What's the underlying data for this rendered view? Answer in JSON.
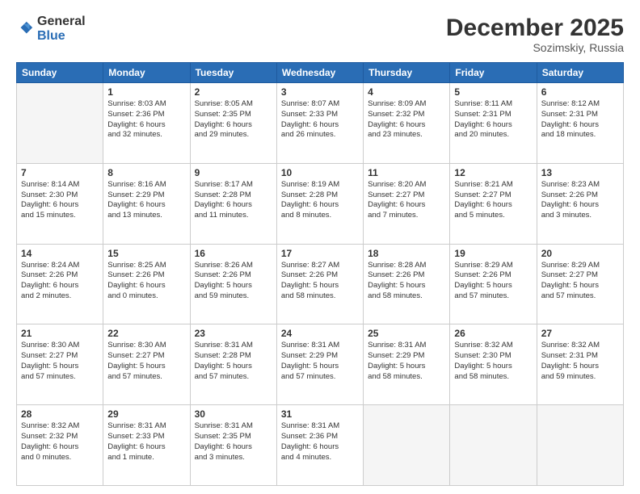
{
  "logo": {
    "general": "General",
    "blue": "Blue"
  },
  "title": "December 2025",
  "location": "Sozimskiy, Russia",
  "days_of_week": [
    "Sunday",
    "Monday",
    "Tuesday",
    "Wednesday",
    "Thursday",
    "Friday",
    "Saturday"
  ],
  "weeks": [
    [
      {
        "day": "",
        "info": "",
        "empty": true
      },
      {
        "day": "1",
        "info": "Sunrise: 8:03 AM\nSunset: 2:36 PM\nDaylight: 6 hours\nand 32 minutes."
      },
      {
        "day": "2",
        "info": "Sunrise: 8:05 AM\nSunset: 2:35 PM\nDaylight: 6 hours\nand 29 minutes."
      },
      {
        "day": "3",
        "info": "Sunrise: 8:07 AM\nSunset: 2:33 PM\nDaylight: 6 hours\nand 26 minutes."
      },
      {
        "day": "4",
        "info": "Sunrise: 8:09 AM\nSunset: 2:32 PM\nDaylight: 6 hours\nand 23 minutes."
      },
      {
        "day": "5",
        "info": "Sunrise: 8:11 AM\nSunset: 2:31 PM\nDaylight: 6 hours\nand 20 minutes."
      },
      {
        "day": "6",
        "info": "Sunrise: 8:12 AM\nSunset: 2:31 PM\nDaylight: 6 hours\nand 18 minutes."
      }
    ],
    [
      {
        "day": "7",
        "info": "Sunrise: 8:14 AM\nSunset: 2:30 PM\nDaylight: 6 hours\nand 15 minutes."
      },
      {
        "day": "8",
        "info": "Sunrise: 8:16 AM\nSunset: 2:29 PM\nDaylight: 6 hours\nand 13 minutes."
      },
      {
        "day": "9",
        "info": "Sunrise: 8:17 AM\nSunset: 2:28 PM\nDaylight: 6 hours\nand 11 minutes."
      },
      {
        "day": "10",
        "info": "Sunrise: 8:19 AM\nSunset: 2:28 PM\nDaylight: 6 hours\nand 8 minutes."
      },
      {
        "day": "11",
        "info": "Sunrise: 8:20 AM\nSunset: 2:27 PM\nDaylight: 6 hours\nand 7 minutes."
      },
      {
        "day": "12",
        "info": "Sunrise: 8:21 AM\nSunset: 2:27 PM\nDaylight: 6 hours\nand 5 minutes."
      },
      {
        "day": "13",
        "info": "Sunrise: 8:23 AM\nSunset: 2:26 PM\nDaylight: 6 hours\nand 3 minutes."
      }
    ],
    [
      {
        "day": "14",
        "info": "Sunrise: 8:24 AM\nSunset: 2:26 PM\nDaylight: 6 hours\nand 2 minutes."
      },
      {
        "day": "15",
        "info": "Sunrise: 8:25 AM\nSunset: 2:26 PM\nDaylight: 6 hours\nand 0 minutes."
      },
      {
        "day": "16",
        "info": "Sunrise: 8:26 AM\nSunset: 2:26 PM\nDaylight: 5 hours\nand 59 minutes."
      },
      {
        "day": "17",
        "info": "Sunrise: 8:27 AM\nSunset: 2:26 PM\nDaylight: 5 hours\nand 58 minutes."
      },
      {
        "day": "18",
        "info": "Sunrise: 8:28 AM\nSunset: 2:26 PM\nDaylight: 5 hours\nand 58 minutes."
      },
      {
        "day": "19",
        "info": "Sunrise: 8:29 AM\nSunset: 2:26 PM\nDaylight: 5 hours\nand 57 minutes."
      },
      {
        "day": "20",
        "info": "Sunrise: 8:29 AM\nSunset: 2:27 PM\nDaylight: 5 hours\nand 57 minutes."
      }
    ],
    [
      {
        "day": "21",
        "info": "Sunrise: 8:30 AM\nSunset: 2:27 PM\nDaylight: 5 hours\nand 57 minutes."
      },
      {
        "day": "22",
        "info": "Sunrise: 8:30 AM\nSunset: 2:27 PM\nDaylight: 5 hours\nand 57 minutes."
      },
      {
        "day": "23",
        "info": "Sunrise: 8:31 AM\nSunset: 2:28 PM\nDaylight: 5 hours\nand 57 minutes."
      },
      {
        "day": "24",
        "info": "Sunrise: 8:31 AM\nSunset: 2:29 PM\nDaylight: 5 hours\nand 57 minutes."
      },
      {
        "day": "25",
        "info": "Sunrise: 8:31 AM\nSunset: 2:29 PM\nDaylight: 5 hours\nand 58 minutes."
      },
      {
        "day": "26",
        "info": "Sunrise: 8:32 AM\nSunset: 2:30 PM\nDaylight: 5 hours\nand 58 minutes."
      },
      {
        "day": "27",
        "info": "Sunrise: 8:32 AM\nSunset: 2:31 PM\nDaylight: 5 hours\nand 59 minutes."
      }
    ],
    [
      {
        "day": "28",
        "info": "Sunrise: 8:32 AM\nSunset: 2:32 PM\nDaylight: 6 hours\nand 0 minutes."
      },
      {
        "day": "29",
        "info": "Sunrise: 8:31 AM\nSunset: 2:33 PM\nDaylight: 6 hours\nand 1 minute."
      },
      {
        "day": "30",
        "info": "Sunrise: 8:31 AM\nSunset: 2:35 PM\nDaylight: 6 hours\nand 3 minutes."
      },
      {
        "day": "31",
        "info": "Sunrise: 8:31 AM\nSunset: 2:36 PM\nDaylight: 6 hours\nand 4 minutes."
      },
      {
        "day": "",
        "info": "",
        "empty": true
      },
      {
        "day": "",
        "info": "",
        "empty": true
      },
      {
        "day": "",
        "info": "",
        "empty": true
      }
    ]
  ]
}
